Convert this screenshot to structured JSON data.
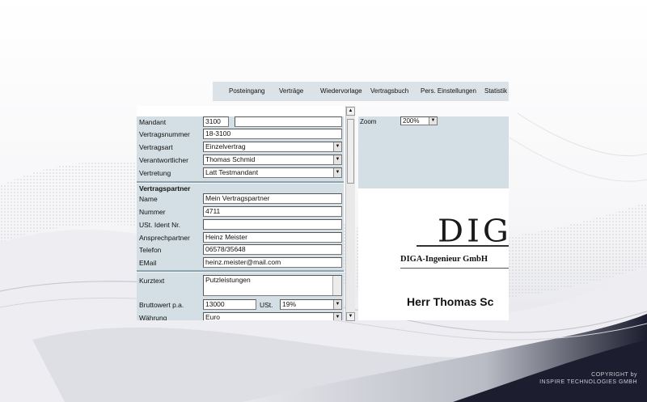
{
  "menu": {
    "items": [
      "Posteingang",
      "Verträge",
      "Wiedervorlage",
      "Vertragsbuch",
      "Pers. Einstellungen",
      "Statistik"
    ]
  },
  "form": {
    "mandant_label": "Mandant",
    "mandant_value": "3100",
    "mandant_name": "",
    "vertragsnummer_label": "Vertragsnummer",
    "vertragsnummer_value": "18-3100",
    "vertragsart_label": "Vertragsart",
    "vertragsart_value": "Einzelvertrag",
    "verantwortlicher_label": "Verantwortlicher",
    "verantwortlicher_value": "Thomas Schmid",
    "vertretung_label": "Vertretung",
    "vertretung_value": "Latt Testmandant",
    "partner_heading": "Vertragspartner",
    "name_label": "Name",
    "name_value": "Mein Vertragspartner",
    "nummer_label": "Nummer",
    "nummer_value": "4711",
    "ust_ident_label": "USt. Ident Nr.",
    "ust_ident_value": "",
    "ansprechpartner_label": "Ansprechpartner",
    "ansprechpartner_value": "Heinz Meister",
    "telefon_label": "Telefon",
    "telefon_value": "06578/35648",
    "email_label": "EMail",
    "email_value": "heinz.meister@mail.com",
    "kurztext_label": "Kurztext",
    "kurztext_value": "Putzleistungen",
    "bruttowert_label": "Bruttowert p.a.",
    "bruttowert_value": "13000",
    "ust_label": "USt.",
    "ust_value": "19%",
    "waehrung_label": "Währung",
    "waehrung_value": "Euro"
  },
  "viewer": {
    "zoom_label": "Zoom",
    "zoom_value": "200%",
    "doc_logo": "DIGA",
    "doc_company": "DIGA-Ingenieur GmbH",
    "doc_recipient": "Herr Thomas Sc"
  },
  "footer": {
    "copyright_line1": "COPYRIGHT by",
    "copyright_line2": "INSPIRE TECHNOLOGIES GMBH"
  },
  "colors": {
    "panel": "#d3dfe4",
    "menubar": "#dbe3e8",
    "separator": "#8fa3ad",
    "swoosh_dark": "#1c1d2e"
  }
}
